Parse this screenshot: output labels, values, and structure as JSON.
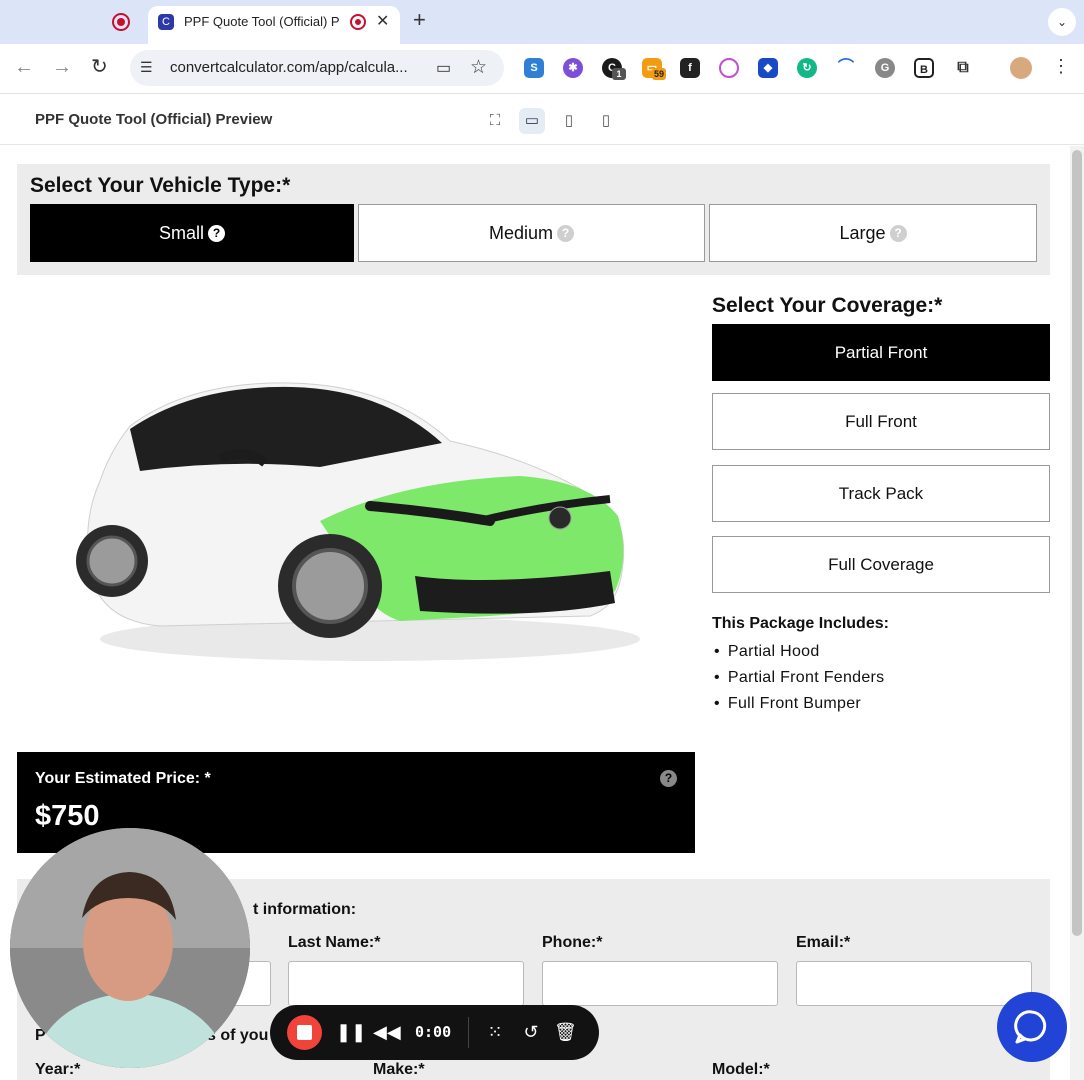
{
  "browser": {
    "active_tab_title": "PPF Quote Tool (Official) P",
    "url": "convertcalculator.com/app/calcula...",
    "extension_badges": [
      "1",
      "59"
    ]
  },
  "preview": {
    "title": "PPF Quote Tool (Official) Preview",
    "device_icons": [
      "fullscreen-icon",
      "desktop-icon",
      "tablet-icon",
      "mobile-icon"
    ]
  },
  "vehicle": {
    "title": "Select Your Vehicle Type:*",
    "options": [
      {
        "label": "Small",
        "selected": true
      },
      {
        "label": "Medium",
        "selected": false
      },
      {
        "label": "Large",
        "selected": false
      }
    ],
    "help_glyph": "?"
  },
  "coverage": {
    "title": "Select Your Coverage:*",
    "options": [
      {
        "label": "Partial Front",
        "selected": true
      },
      {
        "label": "Full Front",
        "selected": false
      },
      {
        "label": "Track Pack",
        "selected": false
      },
      {
        "label": "Full Coverage",
        "selected": false
      }
    ],
    "package_title": "This Package Includes:",
    "package_items": [
      "Partial Hood",
      "Partial Front Fenders",
      "Full Front Bumper"
    ]
  },
  "price": {
    "label": "Your Estimated Price: *",
    "value": "$750",
    "help_glyph": "?"
  },
  "contact": {
    "title_visible": "t information:",
    "last_name_label": "Last Name:*",
    "phone_label": "Phone:*",
    "email_label": "Email:*",
    "vehicle_section_prefix": "P",
    "vehicle_section_suffix": "s of you",
    "year_label": "Year:*",
    "make_label": "Make:*",
    "model_label": "Model:*"
  },
  "recorder": {
    "time": "0:00"
  },
  "colors": {
    "selected": "#000000",
    "ppf_highlight": "#7de86a",
    "recorder_stop": "#f0443a",
    "chat_button": "#2244d6"
  }
}
